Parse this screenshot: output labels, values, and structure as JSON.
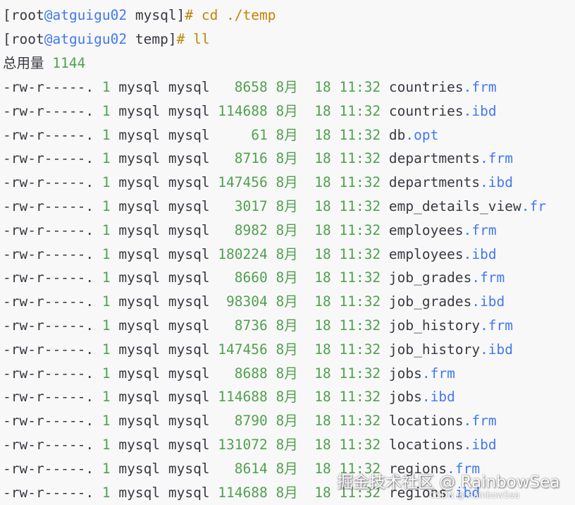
{
  "prompt1": {
    "open": "[",
    "user": "root",
    "at_host": "@atguigu02",
    "dir": "mysql",
    "close": "]",
    "symbol": "#",
    "command": "cd",
    "argument": "./temp"
  },
  "prompt2": {
    "open": "[",
    "user": "root",
    "at_host": "@atguigu02",
    "dir": "temp",
    "close": "]",
    "symbol": "#",
    "command": "ll"
  },
  "total": {
    "label": "总用量",
    "value": "1144"
  },
  "files": [
    {
      "perms": "-rw-r-----.",
      "links": "1",
      "owner": "mysql",
      "group": "mysql",
      "size": "8658",
      "month": "8月",
      "day": "18",
      "time": "11:32",
      "base": "countries",
      "ext": ".frm"
    },
    {
      "perms": "-rw-r-----.",
      "links": "1",
      "owner": "mysql",
      "group": "mysql",
      "size": "114688",
      "month": "8月",
      "day": "18",
      "time": "11:32",
      "base": "countries",
      "ext": ".ibd"
    },
    {
      "perms": "-rw-r-----.",
      "links": "1",
      "owner": "mysql",
      "group": "mysql",
      "size": "61",
      "month": "8月",
      "day": "18",
      "time": "11:32",
      "base": "db",
      "ext": ".opt"
    },
    {
      "perms": "-rw-r-----.",
      "links": "1",
      "owner": "mysql",
      "group": "mysql",
      "size": "8716",
      "month": "8月",
      "day": "18",
      "time": "11:32",
      "base": "departments",
      "ext": ".frm"
    },
    {
      "perms": "-rw-r-----.",
      "links": "1",
      "owner": "mysql",
      "group": "mysql",
      "size": "147456",
      "month": "8月",
      "day": "18",
      "time": "11:32",
      "base": "departments",
      "ext": ".ibd"
    },
    {
      "perms": "-rw-r-----.",
      "links": "1",
      "owner": "mysql",
      "group": "mysql",
      "size": "3017",
      "month": "8月",
      "day": "18",
      "time": "11:32",
      "base": "emp_details_view",
      "ext": ".fr"
    },
    {
      "perms": "-rw-r-----.",
      "links": "1",
      "owner": "mysql",
      "group": "mysql",
      "size": "8982",
      "month": "8月",
      "day": "18",
      "time": "11:32",
      "base": "employees",
      "ext": ".frm"
    },
    {
      "perms": "-rw-r-----.",
      "links": "1",
      "owner": "mysql",
      "group": "mysql",
      "size": "180224",
      "month": "8月",
      "day": "18",
      "time": "11:32",
      "base": "employees",
      "ext": ".ibd"
    },
    {
      "perms": "-rw-r-----.",
      "links": "1",
      "owner": "mysql",
      "group": "mysql",
      "size": "8660",
      "month": "8月",
      "day": "18",
      "time": "11:32",
      "base": "job_grades",
      "ext": ".frm"
    },
    {
      "perms": "-rw-r-----.",
      "links": "1",
      "owner": "mysql",
      "group": "mysql",
      "size": "98304",
      "month": "8月",
      "day": "18",
      "time": "11:32",
      "base": "job_grades",
      "ext": ".ibd"
    },
    {
      "perms": "-rw-r-----.",
      "links": "1",
      "owner": "mysql",
      "group": "mysql",
      "size": "8736",
      "month": "8月",
      "day": "18",
      "time": "11:32",
      "base": "job_history",
      "ext": ".frm"
    },
    {
      "perms": "-rw-r-----.",
      "links": "1",
      "owner": "mysql",
      "group": "mysql",
      "size": "147456",
      "month": "8月",
      "day": "18",
      "time": "11:32",
      "base": "job_history",
      "ext": ".ibd"
    },
    {
      "perms": "-rw-r-----.",
      "links": "1",
      "owner": "mysql",
      "group": "mysql",
      "size": "8688",
      "month": "8月",
      "day": "18",
      "time": "11:32",
      "base": "jobs",
      "ext": ".frm"
    },
    {
      "perms": "-rw-r-----.",
      "links": "1",
      "owner": "mysql",
      "group": "mysql",
      "size": "114688",
      "month": "8月",
      "day": "18",
      "time": "11:32",
      "base": "jobs",
      "ext": ".ibd"
    },
    {
      "perms": "-rw-r-----.",
      "links": "1",
      "owner": "mysql",
      "group": "mysql",
      "size": "8790",
      "month": "8月",
      "day": "18",
      "time": "11:32",
      "base": "locations",
      "ext": ".frm"
    },
    {
      "perms": "-rw-r-----.",
      "links": "1",
      "owner": "mysql",
      "group": "mysql",
      "size": "131072",
      "month": "8月",
      "day": "18",
      "time": "11:32",
      "base": "locations",
      "ext": ".ibd"
    },
    {
      "perms": "-rw-r-----.",
      "links": "1",
      "owner": "mysql",
      "group": "mysql",
      "size": "8614",
      "month": "8月",
      "day": "18",
      "time": "11:32",
      "base": "regions",
      "ext": ".frm"
    },
    {
      "perms": "-rw-r-----.",
      "links": "1",
      "owner": "mysql",
      "group": "mysql",
      "size": "114688",
      "month": "8月",
      "day": "18",
      "time": "11:32",
      "base": "regions",
      "ext": ".ibd"
    }
  ],
  "watermark": {
    "text": "掘金技术社区 @ RainbowSea",
    "subtext": "CSDN @ RainbowSea"
  },
  "colors": {
    "background": "#f8f8f8",
    "text": "#383a42",
    "host": "#4078f2",
    "keyword": "#c18401",
    "number": "#50a14f",
    "extension": "#4078f2"
  }
}
